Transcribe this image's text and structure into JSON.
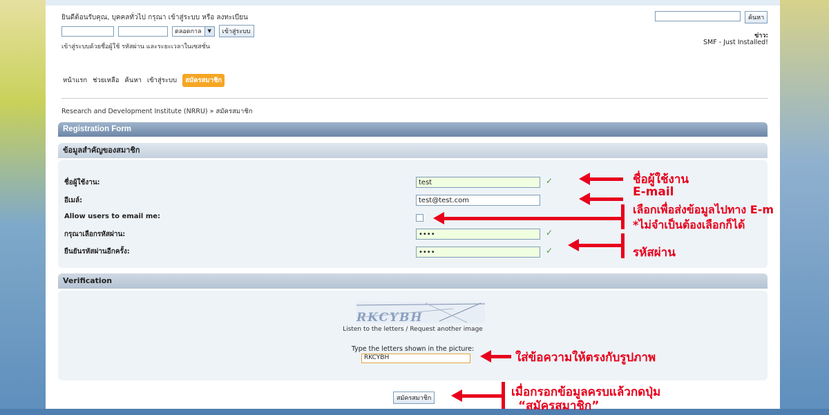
{
  "header": {
    "welcome": "ยินดีต้อนรับคุณ, บุคคลทั่วไป กรุณา เข้าสู่ระบบ หรือ ลงทะเบียน",
    "duration_select": "ตลอดกาล",
    "login_button": "เข้าสู่ระบบ",
    "login_hint": "เข้าสู่ระบบด้วยชื่อผู้ใช้ รหัสผ่าน และระยะเวลาในเซสชั่น",
    "search_button": "ค้นหา",
    "news_label": "ข่าว:",
    "news_text": "SMF - Just Installed!"
  },
  "menu": {
    "home": "หน้าแรก",
    "help": "ช่วยเหลือ",
    "search": "ค้นหา",
    "login": "เข้าสู่ระบบ",
    "register": "สมัครสมาชิก"
  },
  "breadcrumb": "Research and Development Institute (NRRU) » สมัครสมาชิก",
  "form": {
    "title": "Registration Form",
    "section_title": "ข้อมูลสำคัญของสมาชิก",
    "username_label": "ชื่อผู้ใช้งาน:",
    "username_value": "test",
    "email_label": "อีเมล์:",
    "email_value": "test@test.com",
    "allow_email_label": "Allow users to email me:",
    "password_label": "กรุณาเลือกรหัสผ่าน:",
    "password_value": "••••",
    "confirm_label": "ยืนยันรหัสผ่านอีกครั้ง:",
    "confirm_value": "••••"
  },
  "verification": {
    "title": "Verification",
    "captcha_text": "RKCYBH",
    "listen_link": "Listen to the letters",
    "another_link": "Request another image",
    "link_separator": " / ",
    "type_label": "Type the letters shown in the picture:",
    "input_value": "RKCYBH"
  },
  "submit_label": "สมัครสมาชิก",
  "annotations": {
    "username": "ชื่อผู้ใช้งาน",
    "email": "E-mail",
    "allow_email_1": "เลือกเพื่อส่งข้อมูลไปทาง E-m",
    "allow_email_2": "*ไม่จำเป็นต้องเลือกก็ได้",
    "password": "รหัสผ่าน",
    "captcha": "ใส่ข้อความให้ตรงกับรูปภาพ",
    "submit_1": "เมื่อกรอกข้อมูลครบแล้วกดปุ่ม",
    "submit_2": "“สมัครสมาชิก”"
  },
  "colors": {
    "annotation": "#e8001c",
    "menu_active": "#f5a623",
    "category_bar": "#7a93b2",
    "valid_check": "#4a9a3a"
  },
  "icons": {
    "valid": "check-icon",
    "dropdown": "chevron-down-icon",
    "annotation": "arrow-left-icon"
  }
}
